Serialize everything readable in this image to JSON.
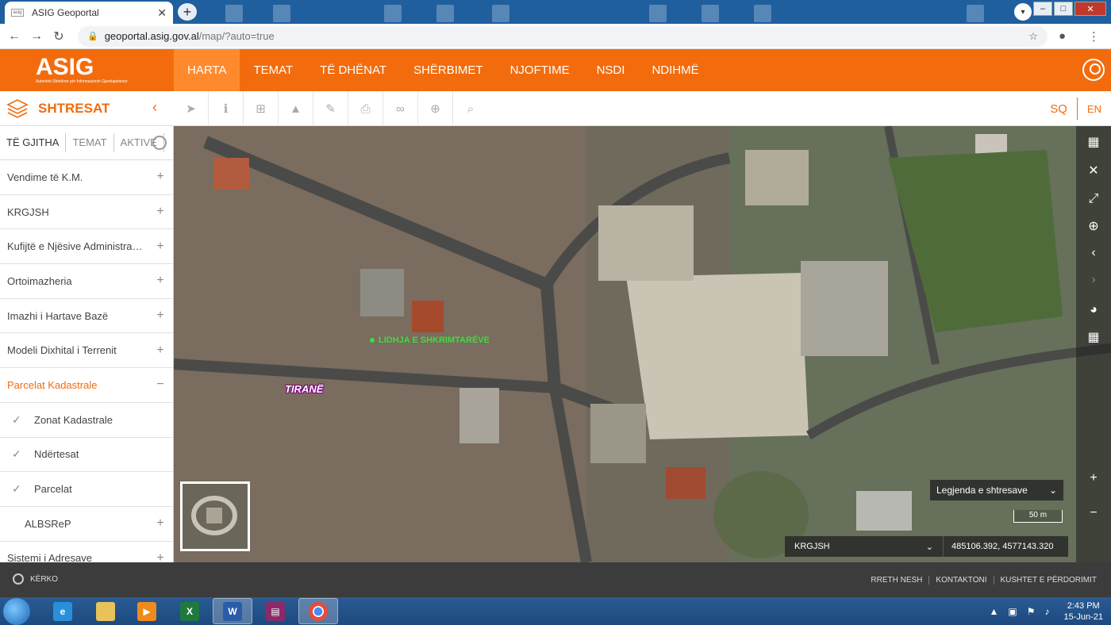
{
  "browser": {
    "tab_title": "ASIG Geoportal",
    "tab_favicon_text": "asig",
    "url_host": "geoportal.asig.gov.al",
    "url_path": "/map/?auto=true"
  },
  "header": {
    "logo_text": "ASIG",
    "logo_subtitle": "Autoriteti Shtetëror për Informacionin Gjeohapësinor",
    "nav": [
      {
        "label": "HARTA"
      },
      {
        "label": "TEMAT"
      },
      {
        "label": "TË DHËNAT"
      },
      {
        "label": "SHËRBIMET"
      },
      {
        "label": "NJOFTIME"
      },
      {
        "label": "NSDI"
      },
      {
        "label": "NDIHMË"
      }
    ]
  },
  "toolbar": {
    "layers_title": "SHTRESAT",
    "lang_sq": "SQ",
    "lang_en": "EN"
  },
  "sidebar": {
    "tabs": [
      {
        "label": "TË GJITHA"
      },
      {
        "label": "TEMAT"
      },
      {
        "label": "AKTIVE"
      }
    ],
    "items": [
      {
        "label": "Vendime të K.M.",
        "sign": "+"
      },
      {
        "label": "KRGJSH",
        "sign": "+"
      },
      {
        "label": "Kufijtë e Njësive Administrative",
        "sign": "+"
      },
      {
        "label": "Ortoimazheria",
        "sign": "+"
      },
      {
        "label": "Imazhi i Hartave Bazë",
        "sign": "+"
      },
      {
        "label": "Modeli Dixhital i Terrenit",
        "sign": "+"
      },
      {
        "label": "Parcelat Kadastrale",
        "sign": "−"
      },
      {
        "label": "Zonat Kadastrale",
        "check": "✓"
      },
      {
        "label": "Ndërtesat",
        "check": "✓"
      },
      {
        "label": "Parcelat",
        "check": "✓"
      },
      {
        "label": "ALBSReP",
        "sign": "+"
      },
      {
        "label": "Sistemi i Adresave",
        "sign": "+"
      }
    ]
  },
  "map": {
    "label_green": "LIDHJA E SHKRIMTARËVE",
    "label_city": "TIRANË",
    "legend_select": "Legjenda e shtresave",
    "scale": "50 m",
    "projection": "KRGJSH",
    "coordinates": "485106.392, 4577143.320"
  },
  "footer": {
    "search": "KËRKO",
    "links": [
      {
        "label": "RRETH NESH"
      },
      {
        "label": "KONTAKTONI"
      },
      {
        "label": "KUSHTET E PËRDORIMIT"
      }
    ]
  },
  "taskbar": {
    "time": "2:43 PM",
    "date": "15-Jun-21"
  },
  "colors": {
    "brand_orange": "#f26c0d",
    "footer_dark": "#3c3c3c",
    "label_green": "#39e03a"
  }
}
